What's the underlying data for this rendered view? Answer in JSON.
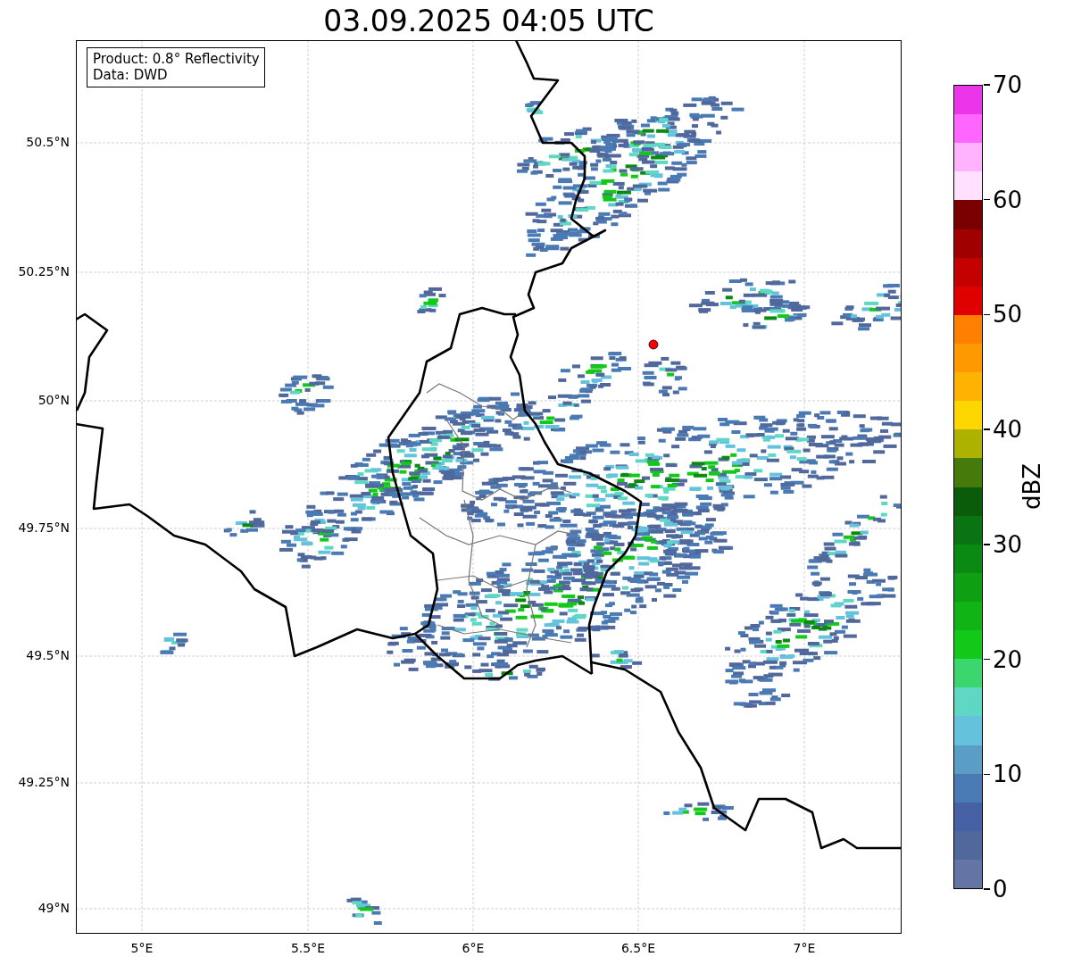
{
  "title": "03.09.2025 04:05 UTC",
  "legend": [
    "Product: 0.8° Reflectivity",
    "Data: DWD"
  ],
  "y_axis": {
    "ticks": [
      "50.5°N",
      "50.25°N",
      "50°N",
      "49.75°N",
      "49.5°N",
      "49.25°N",
      "49°N"
    ]
  },
  "x_axis": {
    "ticks": [
      "5°E",
      "5.5°E",
      "6°E",
      "6.5°E",
      "7°E"
    ]
  },
  "colorbar": {
    "label": "dBZ",
    "ticks": [
      "70",
      "60",
      "50",
      "40",
      "30",
      "20",
      "10",
      "0"
    ],
    "segments": [
      {
        "color": "#ea35ea"
      },
      {
        "color": "#ff66ff"
      },
      {
        "color": "#ffb3ff"
      },
      {
        "color": "#ffe0ff"
      },
      {
        "color": "#7a0000"
      },
      {
        "color": "#a00000"
      },
      {
        "color": "#c40000"
      },
      {
        "color": "#e00000"
      },
      {
        "color": "#ff7f00"
      },
      {
        "color": "#ff9900"
      },
      {
        "color": "#ffb300"
      },
      {
        "color": "#ffd700"
      },
      {
        "color": "#adb200"
      },
      {
        "color": "#467a0a"
      },
      {
        "color": "#0a5c0a"
      },
      {
        "color": "#0a7312"
      },
      {
        "color": "#0a8a12"
      },
      {
        "color": "#0ea012"
      },
      {
        "color": "#10b414"
      },
      {
        "color": "#12c818"
      },
      {
        "color": "#3cd66e"
      },
      {
        "color": "#5ed8c4"
      },
      {
        "color": "#64c2dc"
      },
      {
        "color": "#5a9ec8"
      },
      {
        "color": "#4a7ab4"
      },
      {
        "color": "#4660a4"
      },
      {
        "color": "#50689c"
      },
      {
        "color": "#6474a4"
      }
    ]
  }
}
